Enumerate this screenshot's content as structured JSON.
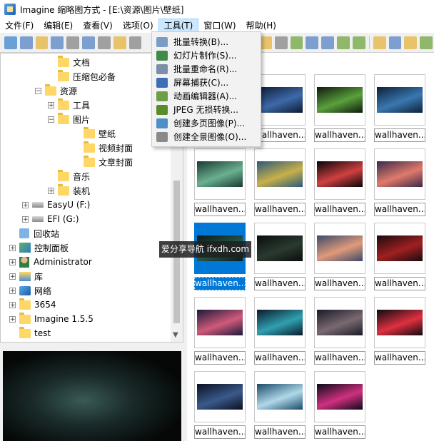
{
  "window": {
    "title": "Imagine 缩略图方式 - [E:\\资源\\图片\\壁纸]"
  },
  "menu": [
    {
      "label": "文件(F)"
    },
    {
      "label": "编辑(E)"
    },
    {
      "label": "查看(V)"
    },
    {
      "label": "选项(O)"
    },
    {
      "label": "工具(T)"
    },
    {
      "label": "窗口(W)"
    },
    {
      "label": "帮助(H)"
    }
  ],
  "tools_menu": [
    {
      "label": "批量转换(B)...",
      "icon": "batch-convert-icon",
      "color": "#7a9cc6"
    },
    {
      "label": "幻灯片制作(S)...",
      "icon": "slideshow-icon",
      "color": "#3f8a4a"
    },
    {
      "label": "批量重命名(R)...",
      "icon": "batch-rename-icon",
      "color": "#7d8fa8"
    },
    {
      "label": "屏幕捕获(C)...",
      "icon": "screen-capture-icon",
      "color": "#3c6fb5"
    },
    {
      "label": "动画编辑器(A)...",
      "icon": "animation-editor-icon",
      "color": "#6ba046"
    },
    {
      "label": "JPEG 无损转换...",
      "icon": "jpeg-icon",
      "color": "#5b8c2a"
    },
    {
      "label": "创建多页图像(P)...",
      "icon": "multipage-icon",
      "color": "#4f8fc7"
    },
    {
      "label": "创建全景图像(O)...",
      "icon": "panorama-icon",
      "color": "#8a8a8a"
    }
  ],
  "tree": [
    {
      "label": "文档",
      "icon": "folder-icon"
    },
    {
      "label": "压缩包必备",
      "icon": "folder-icon"
    },
    {
      "label": "资源",
      "icon": "folder-icon",
      "expander": "−"
    },
    {
      "label": "工具",
      "icon": "folder-icon",
      "expander": "+"
    },
    {
      "label": "图片",
      "icon": "folder-icon",
      "expander": "−"
    },
    {
      "label": "壁纸",
      "icon": "folder-icon"
    },
    {
      "label": "视频封面",
      "icon": "folder-icon"
    },
    {
      "label": "文章封面",
      "icon": "folder-icon"
    },
    {
      "label": "音乐",
      "icon": "folder-icon"
    },
    {
      "label": "装机",
      "icon": "folder-icon",
      "expander": "+"
    },
    {
      "label": "EasyU (F:)",
      "icon": "drive-icon",
      "expander": "+"
    },
    {
      "label": "EFI (G:)",
      "icon": "drive-icon",
      "expander": "+"
    },
    {
      "label": "回收站",
      "icon": "recycle-bin-icon"
    },
    {
      "label": "控制面板",
      "icon": "control-panel-icon",
      "expander": "+"
    },
    {
      "label": "Administrator",
      "icon": "user-icon",
      "expander": "+"
    },
    {
      "label": "库",
      "icon": "library-icon",
      "expander": "+"
    },
    {
      "label": "网络",
      "icon": "network-icon",
      "expander": "+"
    },
    {
      "label": "3654",
      "icon": "folder-icon",
      "expander": "+"
    },
    {
      "label": "Imagine 1.5.5",
      "icon": "folder-icon",
      "expander": "+"
    },
    {
      "label": "test",
      "icon": "folder-icon"
    }
  ],
  "thumbnails": [
    {
      "caption": "wallhaven...",
      "c1": "#1b2a4a",
      "c2": "#c86a8a"
    },
    {
      "caption": "wallhaven...",
      "c1": "#0d1a33",
      "c2": "#3d6aa8"
    },
    {
      "caption": "wallhaven...",
      "c1": "#0f1a0c",
      "c2": "#5aa03c"
    },
    {
      "caption": "wallhaven...",
      "c1": "#0d2038",
      "c2": "#3a78b0"
    },
    {
      "caption": "wallhaven...",
      "c1": "#1a3a32",
      "c2": "#6ab090"
    },
    {
      "caption": "wallhaven...",
      "c1": "#2a5a7a",
      "c2": "#c8b04a"
    },
    {
      "caption": "wallhaven...",
      "c1": "#050508",
      "c2": "#d04040"
    },
    {
      "caption": "wallhaven...",
      "c1": "#3a2a4a",
      "c2": "#e07a6a"
    },
    {
      "caption": "wallhaven...",
      "c1": "#0a1a18",
      "c2": "#2a5a48",
      "selected": true
    },
    {
      "caption": "wallhaven...",
      "c1": "#0a0d0c",
      "c2": "#2a3a30"
    },
    {
      "caption": "wallhaven...",
      "c1": "#3a4a6a",
      "c2": "#e09a7a"
    },
    {
      "caption": "wallhaven...",
      "c1": "#1a0a10",
      "c2": "#a02020"
    },
    {
      "caption": "wallhaven...",
      "c1": "#1a1a3a",
      "c2": "#d05a7a"
    },
    {
      "caption": "wallhaven...",
      "c1": "#0a1a2a",
      "c2": "#30a0b0"
    },
    {
      "caption": "wallhaven...",
      "c1": "#1a1a28",
      "c2": "#7a6a70"
    },
    {
      "caption": "wallhaven...",
      "c1": "#0a0a10",
      "c2": "#e03040"
    },
    {
      "caption": "wallhaven...",
      "c1": "#0a1020",
      "c2": "#3a5a8a"
    },
    {
      "caption": "wallhaven...",
      "c1": "#1a4a6a",
      "c2": "#b0d8e8"
    },
    {
      "caption": "wallhaven...",
      "c1": "#0a0a1a",
      "c2": "#d03080"
    }
  ],
  "watermark": "爱分享导航 ifxdh.com",
  "toolbar_icons": [
    "view-icon",
    "browse-icon",
    "open-folder-icon",
    "save-icon",
    "print-icon",
    "info-icon",
    "camera-icon",
    "folder-icon",
    "rename-icon"
  ],
  "toolbar_right_icons": [
    "zoom-icon",
    "clock-icon",
    "tree-icon",
    "grid-icon",
    "grid-large-icon",
    "thumb-icon",
    "thumb-large-icon",
    "folder-up-icon",
    "back-icon",
    "forward-icon",
    "refresh-icon"
  ]
}
